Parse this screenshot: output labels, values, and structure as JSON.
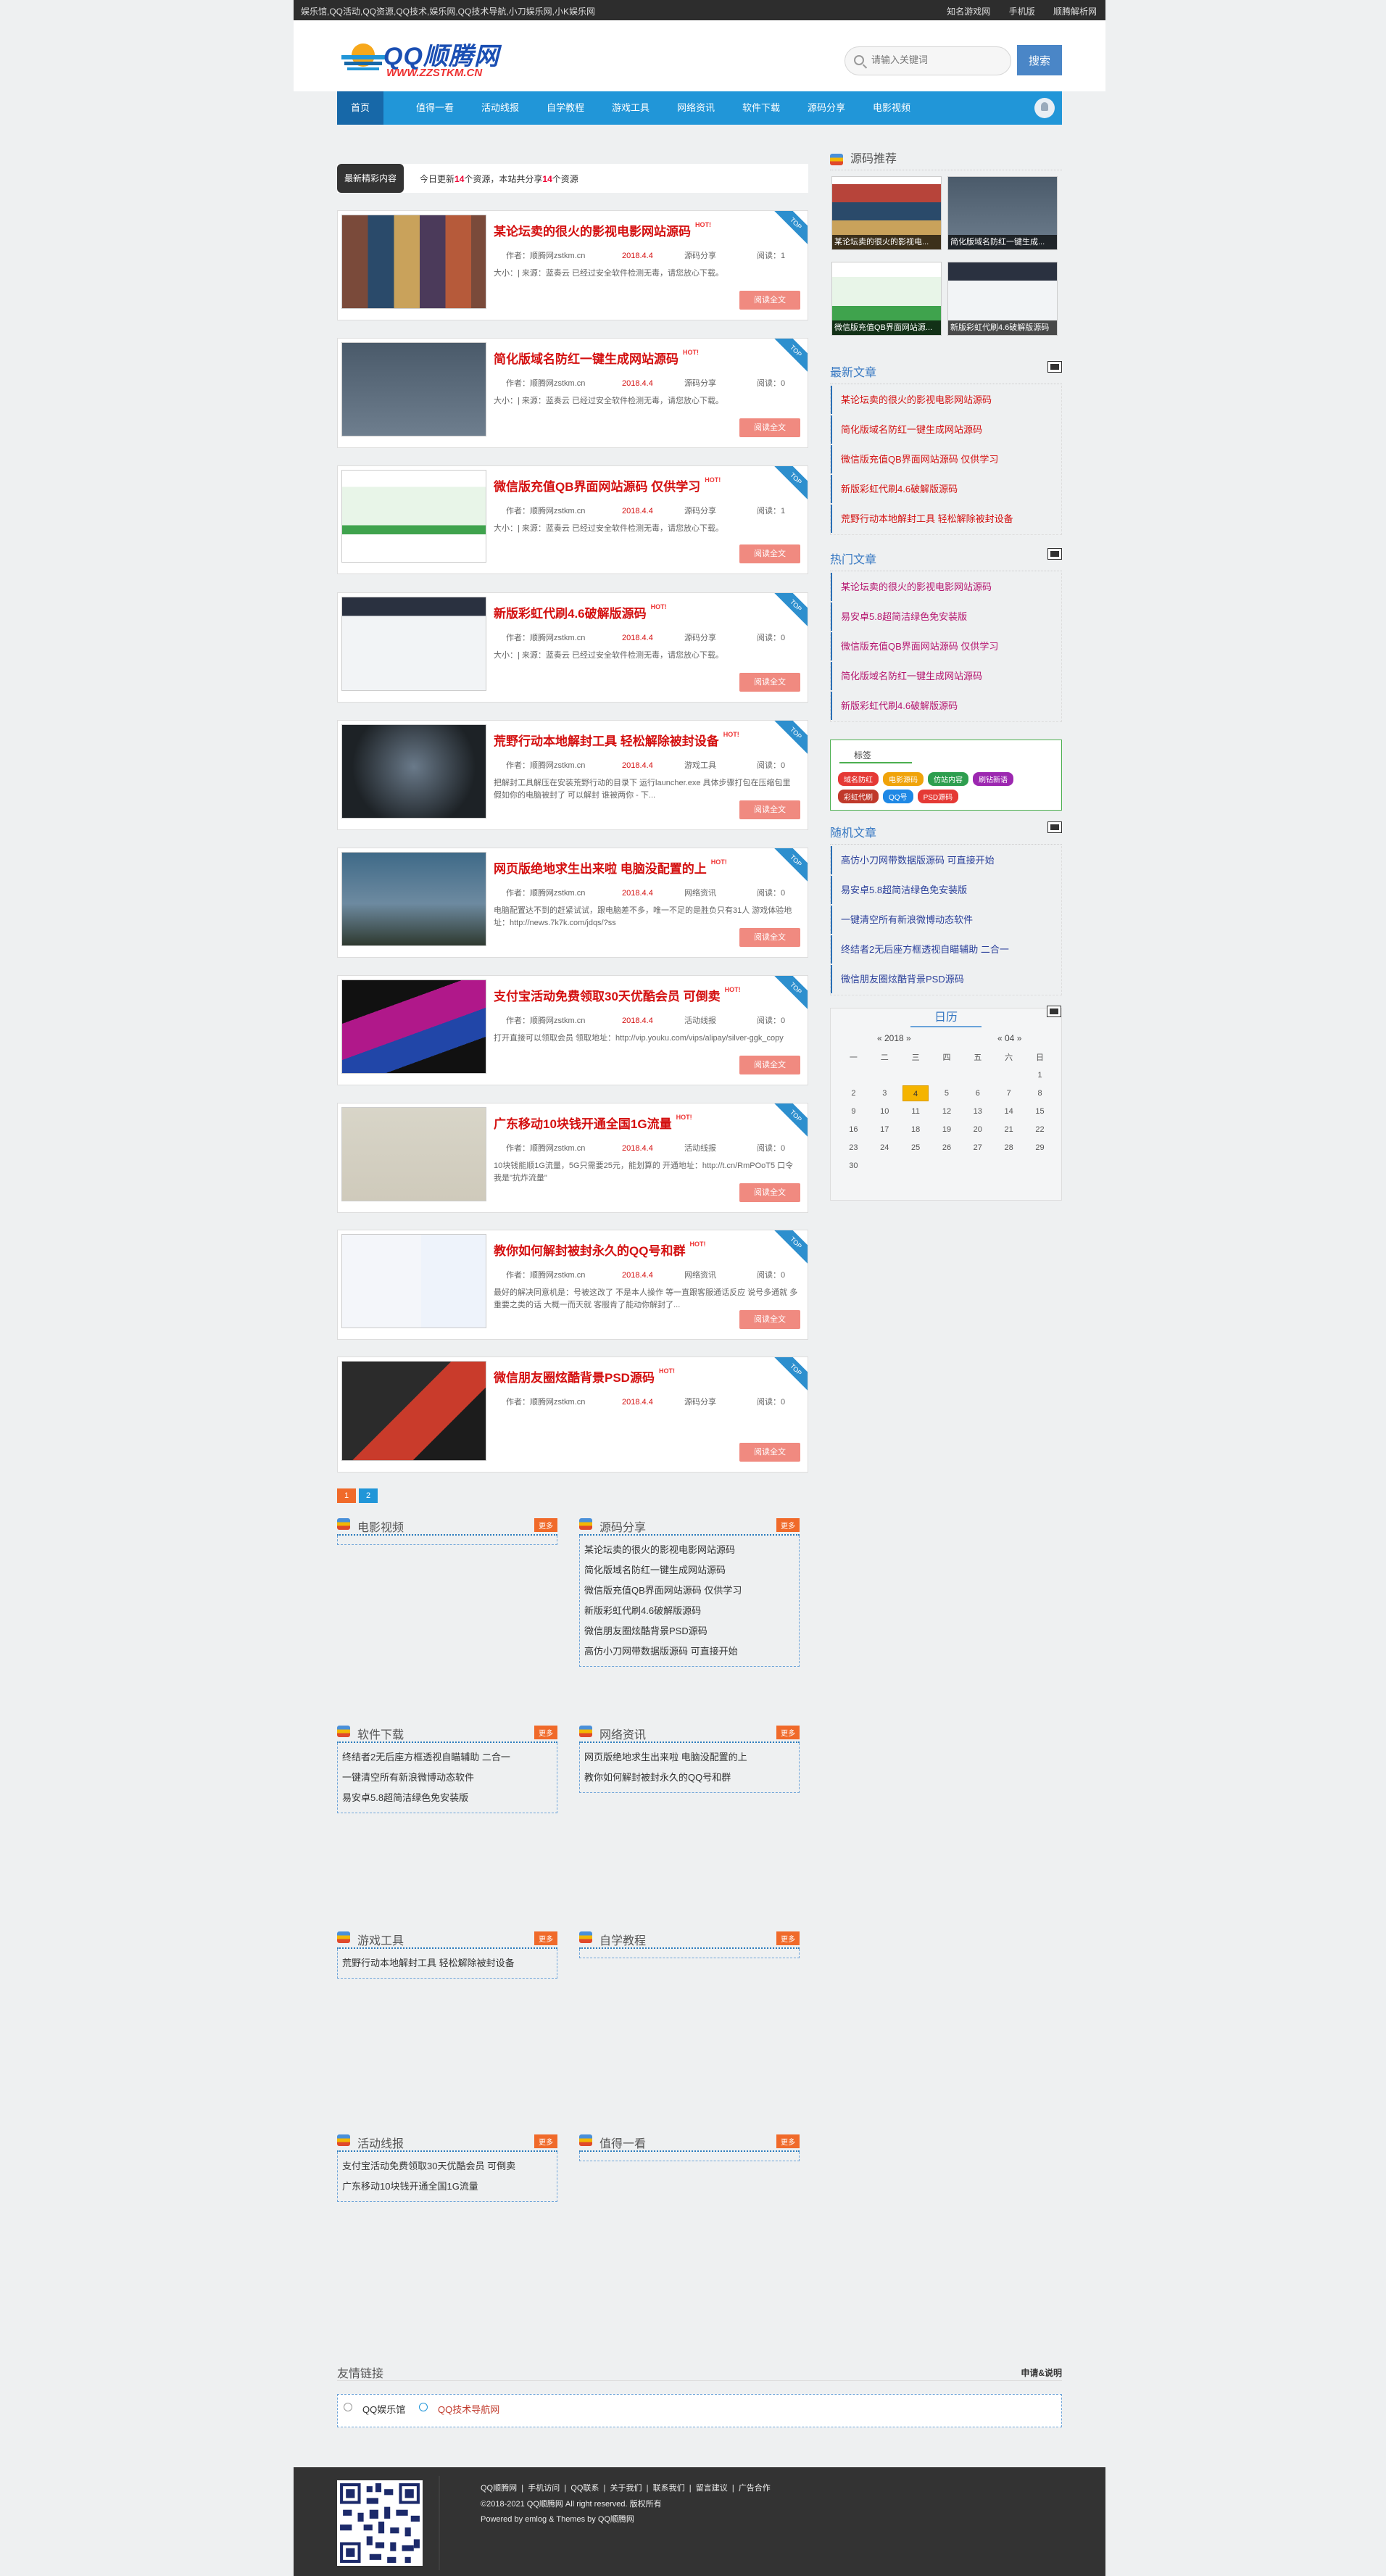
{
  "topbar": {
    "left": "娱乐馆,QQ活动,QQ资源,QQ技术,娱乐网,QQ技术导航,小刀娱乐网,小K娱乐网",
    "right": [
      "知名游戏网",
      "手机版",
      "顺腾解析网"
    ]
  },
  "logo": {
    "main": "QQ顺腾网",
    "sub": "WWW.ZZSTKM.CN"
  },
  "search": {
    "placeholder": "请输入关键词",
    "button": "搜索"
  },
  "nav": [
    "首页",
    "值得一看",
    "活动线报",
    "自学教程",
    "游戏工具",
    "网络资讯",
    "软件下载",
    "源码分享",
    "电影视频"
  ],
  "notice": {
    "tag": "最新精彩内容",
    "pre": "今日更新",
    "today": "14",
    "mid": "个资源，本站共分享",
    "total": "14",
    "post": "个资源"
  },
  "posts": [
    {
      "title": "某论坛卖的很火的影视电影网站源码",
      "hot": "HOT!",
      "author": "作者：顺腾网zstkm.cn",
      "date": "2018.4.4",
      "cat": "源码分享",
      "views": "阅读：1",
      "excerpt": "大小：| 来源：蓝奏云 已经过安全软件检测无毒，请您放心下载。",
      "more": "阅读全文",
      "ribbon": "TOP"
    },
    {
      "title": "简化版域名防红一键生成网站源码",
      "hot": "HOT!",
      "author": "作者：顺腾网zstkm.cn",
      "date": "2018.4.4",
      "cat": "源码分享",
      "views": "阅读：0",
      "excerpt": "大小：| 来源：蓝奏云 已经过安全软件检测无毒，请您放心下载。",
      "more": "阅读全文",
      "ribbon": "TOP"
    },
    {
      "title": "微信版充值QB界面网站源码 仅供学习",
      "hot": "HOT!",
      "author": "作者：顺腾网zstkm.cn",
      "date": "2018.4.4",
      "cat": "源码分享",
      "views": "阅读：1",
      "excerpt": "大小：| 来源：蓝奏云 已经过安全软件检测无毒，请您放心下载。",
      "more": "阅读全文",
      "ribbon": "TOP"
    },
    {
      "title": "新版彩虹代刷4.6破解版源码",
      "hot": "HOT!",
      "author": "作者：顺腾网zstkm.cn",
      "date": "2018.4.4",
      "cat": "源码分享",
      "views": "阅读：0",
      "excerpt": "大小：| 来源：蓝奏云 已经过安全软件检测无毒，请您放心下载。",
      "more": "阅读全文",
      "ribbon": "TOP"
    },
    {
      "title": "荒野行动本地解封工具 轻松解除被封设备",
      "hot": "HOT!",
      "author": "作者：顺腾网zstkm.cn",
      "date": "2018.4.4",
      "cat": "游戏工具",
      "views": "阅读：0",
      "excerpt": "把解封工具解压在安装荒野行动的目录下 运行launcher.exe 具体步骤打包在压缩包里 假如你的电脑被封了 可以解封 谁被两你 - 下...",
      "more": "阅读全文",
      "ribbon": "TOP"
    },
    {
      "title": "网页版绝地求生出来啦 电脑没配置的上",
      "hot": "HOT!",
      "author": "作者：顺腾网zstkm.cn",
      "date": "2018.4.4",
      "cat": "网络资讯",
      "views": "阅读：0",
      "excerpt": "电脑配置达不到的赶紧试试，跟电脑差不多，唯一不足的是胜负只有31人 游戏体验地址：http://news.7k7k.com/jdqs/?ss",
      "more": "阅读全文",
      "ribbon": "TOP"
    },
    {
      "title": "支付宝活动免费领取30天优酷会员 可倒卖",
      "hot": "HOT!",
      "author": "作者：顺腾网zstkm.cn",
      "date": "2018.4.4",
      "cat": "活动线报",
      "views": "阅读：0",
      "excerpt": "打开直接可以领取会员 领取地址：http://vip.youku.com/vips/alipay/silver-ggk_copy",
      "more": "阅读全文",
      "ribbon": "TOP"
    },
    {
      "title": "广东移动10块钱开通全国1G流量",
      "hot": "HOT!",
      "author": "作者：顺腾网zstkm.cn",
      "date": "2018.4.4",
      "cat": "活动线报",
      "views": "阅读：0",
      "excerpt": "10块钱能顺1G流量，5G只需要25元，能划算的 开通地址：http://t.cn/RmPOoT5 口令我是\"抗炸流量\"",
      "more": "阅读全文",
      "ribbon": "TOP"
    },
    {
      "title": "教你如何解封被封永久的QQ号和群",
      "hot": "HOT!",
      "author": "作者：顺腾网zstkm.cn",
      "date": "2018.4.4",
      "cat": "网络资讯",
      "views": "阅读：0",
      "excerpt": "最好的解决同意机是：号被这改了 不是本人操作 等一直跟客服通话反应 说号多通就 多重要之类的话 大概一而天就 客服肯了能动你解封了...",
      "more": "阅读全文",
      "ribbon": "TOP"
    },
    {
      "title": "微信朋友圈炫酷背景PSD源码",
      "hot": "HOT!",
      "author": "作者：顺腾网zstkm.cn",
      "date": "2018.4.4",
      "cat": "源码分享",
      "views": "阅读：0",
      "excerpt": "",
      "more": "阅读全文",
      "ribbon": "TOP"
    }
  ],
  "pager": [
    "1",
    "2"
  ],
  "boxes": [
    {
      "title": "电影视频",
      "more": "更多",
      "items": []
    },
    {
      "title": "源码分享",
      "more": "更多",
      "items": [
        "某论坛卖的很火的影视电影网站源码",
        "简化版域名防红一键生成网站源码",
        "微信版充值QB界面网站源码 仅供学习",
        "新版彩虹代刷4.6破解版源码",
        "微信朋友圈炫酷背景PSD源码",
        "高仿小刀网带数据版源码 可直接开始"
      ]
    },
    {
      "title": "软件下载",
      "more": "更多",
      "items": [
        "终结者2无后座方框透视自瞄辅助 二合一",
        "一键清空所有新浪微博动态软件",
        "易安卓5.8超简洁绿色免安装版"
      ]
    },
    {
      "title": "网络资讯",
      "more": "更多",
      "items": [
        "网页版绝地求生出来啦 电脑没配置的上",
        "教你如何解封被封永久的QQ号和群"
      ]
    },
    {
      "title": "游戏工具",
      "more": "更多",
      "items": [
        "荒野行动本地解封工具 轻松解除被封设备"
      ]
    },
    {
      "title": "自学教程",
      "more": "更多",
      "items": []
    },
    {
      "title": "活动线报",
      "more": "更多",
      "items": [
        "支付宝活动免费领取30天优酷会员 可倒卖",
        "广东移动10块钱开通全国1G流量"
      ]
    },
    {
      "title": "值得一看",
      "more": "更多",
      "items": []
    }
  ],
  "sidebar": {
    "rec_title": "源码推荐",
    "rec": [
      "某论坛卖的很火的影视电...",
      "简化版域名防红一键生成...",
      "微信版充值QB界面网站源...",
      "新版彩虹代刷4.6破解版源码"
    ],
    "latest_title": "最新文章",
    "latest": [
      "某论坛卖的很火的影视电影网站源码",
      "简化版域名防红一键生成网站源码",
      "微信版充值QB界面网站源码 仅供学习",
      "新版彩虹代刷4.6破解版源码",
      "荒野行动本地解封工具 轻松解除被封设备"
    ],
    "hot_title": "热门文章",
    "hot": [
      "某论坛卖的很火的影视电影网站源码",
      "易安卓5.8超简洁绿色免安装版",
      "微信版充值QB界面网站源码 仅供学习",
      "简化版域名防红一键生成网站源码",
      "新版彩虹代刷4.6破解版源码"
    ],
    "tags_title": "标签",
    "tags": [
      {
        "label": "域名防红",
        "color": "#e53935"
      },
      {
        "label": "电影源码",
        "color": "#f0a30a"
      },
      {
        "label": "仿站内容",
        "color": "#2e9e4f"
      },
      {
        "label": "刷钻新语",
        "color": "#9c27b0"
      },
      {
        "label": "彩虹代刷",
        "color": "#c0392b"
      },
      {
        "label": "QQ号",
        "color": "#1e88e5"
      },
      {
        "label": "PSD源码",
        "color": "#e53935"
      }
    ],
    "random_title": "随机文章",
    "random": [
      "高仿小刀网带数据版源码 可直接开始",
      "易安卓5.8超简洁绿色免安装版",
      "一键清空所有新浪微博动态软件",
      "终结者2无后座方框透视自瞄辅助 二合一",
      "微信朋友圈炫酷背景PSD源码"
    ],
    "cal_title": "日历",
    "cal_year": "« 2018 »",
    "cal_month": "« 04 »",
    "cal_week": [
      "一",
      "二",
      "三",
      "四",
      "五",
      "六",
      "日"
    ],
    "cal_rows": [
      [
        "",
        "",
        "",
        "",
        "",
        "",
        "1"
      ],
      [
        "2",
        "3",
        "4",
        "5",
        "6",
        "7",
        "8"
      ],
      [
        "9",
        "10",
        "11",
        "12",
        "13",
        "14",
        "15"
      ],
      [
        "16",
        "17",
        "18",
        "19",
        "20",
        "21",
        "22"
      ],
      [
        "23",
        "24",
        "25",
        "26",
        "27",
        "28",
        "29"
      ],
      [
        "30",
        "",
        "",
        "",
        "",
        "",
        ""
      ]
    ],
    "cal_today": "4"
  },
  "links": {
    "title": "友情链接",
    "apply": "申请&说明",
    "items": [
      "QQ娱乐馆",
      "QQ技术导航网"
    ]
  },
  "footer": {
    "nav": [
      "QQ顺腾网",
      "手机访问",
      "QQ联系",
      "关于我们",
      "联系我们",
      "留言建议",
      "广告合作"
    ],
    "copy": "©2018-2021 QQ顺腾网 All right reserved. 版权所有",
    "powered": "Powered by emlog & Themes by QQ顺腾网"
  }
}
